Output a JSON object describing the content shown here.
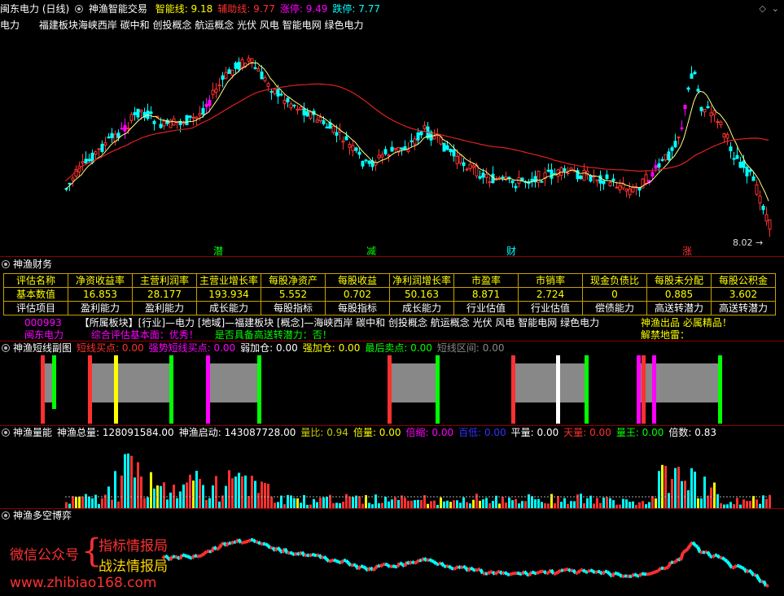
{
  "header": {
    "stock": "闽东电力 (日线)",
    "indicator": "神渔智能交易",
    "items": [
      {
        "label": "智能线:",
        "value": "9.18",
        "color": "#ffff00"
      },
      {
        "label": "辅助线:",
        "value": "9.77",
        "color": "#ff3030"
      },
      {
        "label": "涨停:",
        "value": "9.49",
        "color": "#ff00ff"
      },
      {
        "label": "跌停:",
        "value": "7.77",
        "color": "#00ffff"
      }
    ],
    "concepts_prefix": "电力",
    "concepts": "福建板块海峡西岸 碳中和 创投概念 航运概念 光伏 风电 智能电网 绿色电力"
  },
  "main_chart": {
    "last_price_label": "8.02",
    "markers": [
      {
        "text": "潜",
        "color": "#00ff00"
      },
      {
        "text": "减",
        "color": "#00ff00"
      },
      {
        "text": "财",
        "color": "#00ffff"
      },
      {
        "text": "涨",
        "color": "#ff3030"
      }
    ]
  },
  "finance": {
    "title": "神渔财务",
    "headers": [
      "评估名称",
      "净资收益率",
      "主营利润率",
      "主营业增长率",
      "每股净资产",
      "每股收益",
      "净利润增长率",
      "市盈率",
      "市销率",
      "现金负债比",
      "每股未分配",
      "每股公积金"
    ],
    "values": [
      "基本数值",
      "16.853",
      "28.177",
      "193.934",
      "5.552",
      "0.702",
      "50.163",
      "8.871",
      "2.724",
      "0",
      "0.885",
      "3.602"
    ],
    "items": [
      "评估项目",
      "盈利能力",
      "盈利能力",
      "成长能力",
      "每股指标",
      "每股指标",
      "成长能力",
      "行业估值",
      "行业估值",
      "偿债能力",
      "高送转潜力",
      "高送转潜力"
    ],
    "code": "000993",
    "sector_line": "【所属板块】[行业]—电力 [地域]—福建板块 [概念]—海峡西岸 碳中和 创投概念 航运概念 光伏 风电 智能电网 绿色电力",
    "name": "闽东电力",
    "evaluation": "综合评估基本面：优秀！",
    "potential": "是否具备高送转潜力：否！",
    "slogan": "神渔出品 必属精品！",
    "mine": "解禁地雷："
  },
  "short_panel": {
    "title": "神渔短线副图",
    "items": [
      {
        "label": "短线买点:",
        "value": "0.00",
        "color": "#ff3030"
      },
      {
        "label": "强势短线买点:",
        "value": "0.00",
        "color": "#ff00ff"
      },
      {
        "label": "弱加仓:",
        "value": "0.00",
        "color": "#ffffff"
      },
      {
        "label": "强加仓:",
        "value": "0.00",
        "color": "#ffff00"
      },
      {
        "label": "最后卖点:",
        "value": "0.00",
        "color": "#00ff00"
      },
      {
        "label": "短线区间:",
        "value": "0.00",
        "color": "#888888"
      }
    ]
  },
  "volume_panel": {
    "title": "神渔量能",
    "total_label": "神渔总量:",
    "total_value": "128091584.00",
    "start_label": "神渔启动:",
    "start_value": "143087728.00",
    "items": [
      {
        "label": "量比:",
        "value": "0.94",
        "color": "#cccc00"
      },
      {
        "label": "倍量:",
        "value": "0.00",
        "color": "#ffff00"
      },
      {
        "label": "倍缩:",
        "value": "0.00",
        "color": "#ff00ff"
      },
      {
        "label": "百低:",
        "value": "0.00",
        "color": "#3030ff"
      },
      {
        "label": "平量:",
        "value": "0.00",
        "color": "#ffffff"
      },
      {
        "label": "天量:",
        "value": "0.00",
        "color": "#ff3030"
      },
      {
        "label": "量王:",
        "value": "0.00",
        "color": "#00ff00"
      },
      {
        "label": "倍数:",
        "value": "0.83",
        "color": "#ffffff"
      }
    ]
  },
  "bull_bear": {
    "title": "神渔多空博弈"
  },
  "watermark": {
    "wechat": "微信公众号",
    "line1": "指标情报局",
    "line2": "战法情报局",
    "url": "www.zhibiao168.com"
  }
}
